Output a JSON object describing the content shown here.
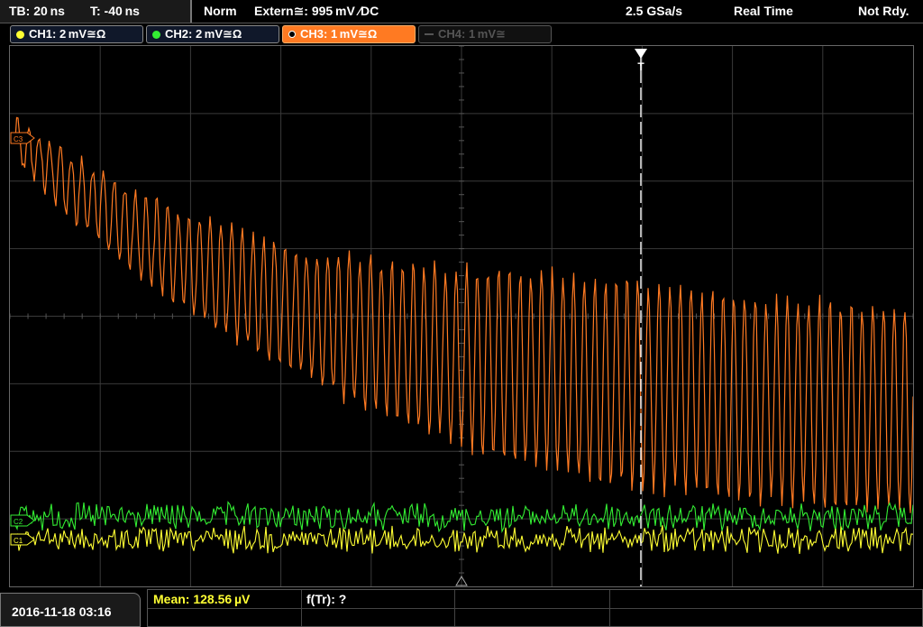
{
  "top_bar": {
    "timebase": "TB: 20 ns",
    "trigger_time": "T: -40 ns",
    "mode": "Norm",
    "trigger_source": "Extern≅: 995 mV ∕DC",
    "sample_rate": "2.5 GSa/s",
    "acquisition": "Real Time",
    "status": "Not Rdy."
  },
  "channels": [
    {
      "label": "CH1: 2 mV≅Ω",
      "color": "#ffff33",
      "state": "on"
    },
    {
      "label": "CH2: 2 mV≅Ω",
      "color": "#33ee33",
      "state": "on"
    },
    {
      "label": "CH3: 1 mV≅Ω",
      "color": "#ff7a22",
      "state": "active"
    },
    {
      "label": "CH4: 1 mV≅",
      "color": "#555555",
      "state": "off"
    }
  ],
  "markers": {
    "ch3": "C3",
    "ch2": "C2",
    "ch1": "C1",
    "trigger": "T"
  },
  "colors": {
    "ch1": "#ffff33",
    "ch2": "#33ee33",
    "ch3": "#ff7a22",
    "grid": "#3a3a3a"
  },
  "bottom_bar": {
    "datetime": "2016-11-18 03:16",
    "measurement_1": "Mean: 128.56 µV",
    "measurement_2": "f(Tr): ?"
  }
}
